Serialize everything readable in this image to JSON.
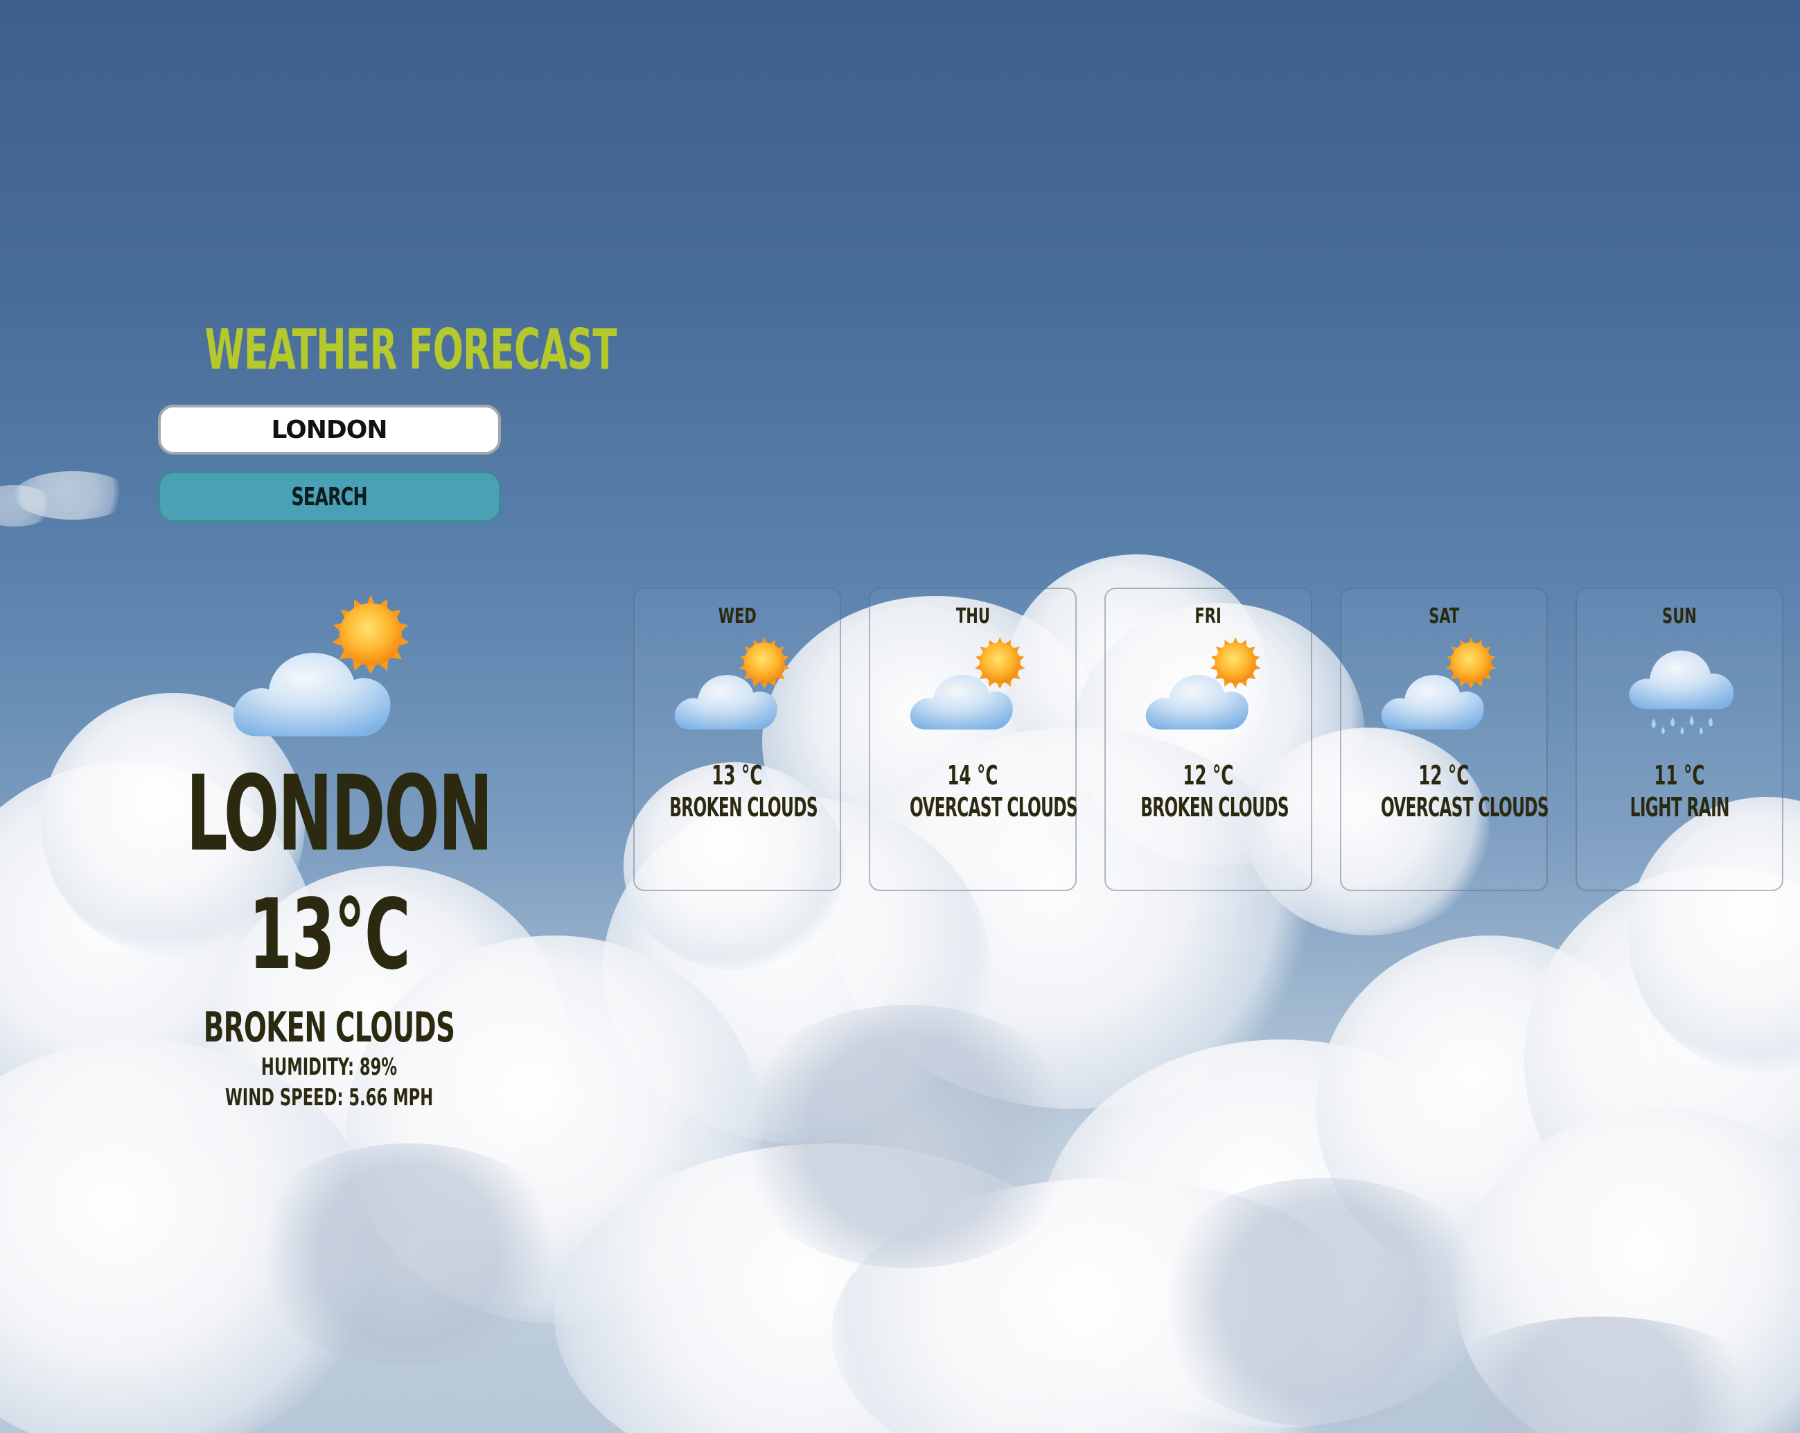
{
  "app": {
    "title": "Weather Forecast"
  },
  "search": {
    "value": "London",
    "button_label": "Search"
  },
  "current": {
    "city": "London",
    "temp": "13°C",
    "description": "Broken Clouds",
    "humidity": "Humidity: 89%",
    "wind": "Wind Speed: 5.66 mph",
    "icon": "partly-cloudy-icon"
  },
  "forecast": [
    {
      "day": "Wed",
      "temp": "13 °C",
      "description": "Broken Clouds",
      "icon": "partly-cloudy-icon"
    },
    {
      "day": "Thu",
      "temp": "14 °C",
      "description": "Overcast Clouds",
      "icon": "partly-cloudy-icon"
    },
    {
      "day": "Fri",
      "temp": "12 °C",
      "description": "Broken Clouds",
      "icon": "partly-cloudy-icon"
    },
    {
      "day": "Sat",
      "temp": "12 °C",
      "description": "Overcast Clouds",
      "icon": "partly-cloudy-icon"
    },
    {
      "day": "Sun",
      "temp": "11 °C",
      "description": "Light Rain",
      "icon": "rain-cloud-icon"
    }
  ],
  "colors": {
    "title": "#b5c92c",
    "button": "#4aa0b4",
    "text": "#2b2a10"
  }
}
